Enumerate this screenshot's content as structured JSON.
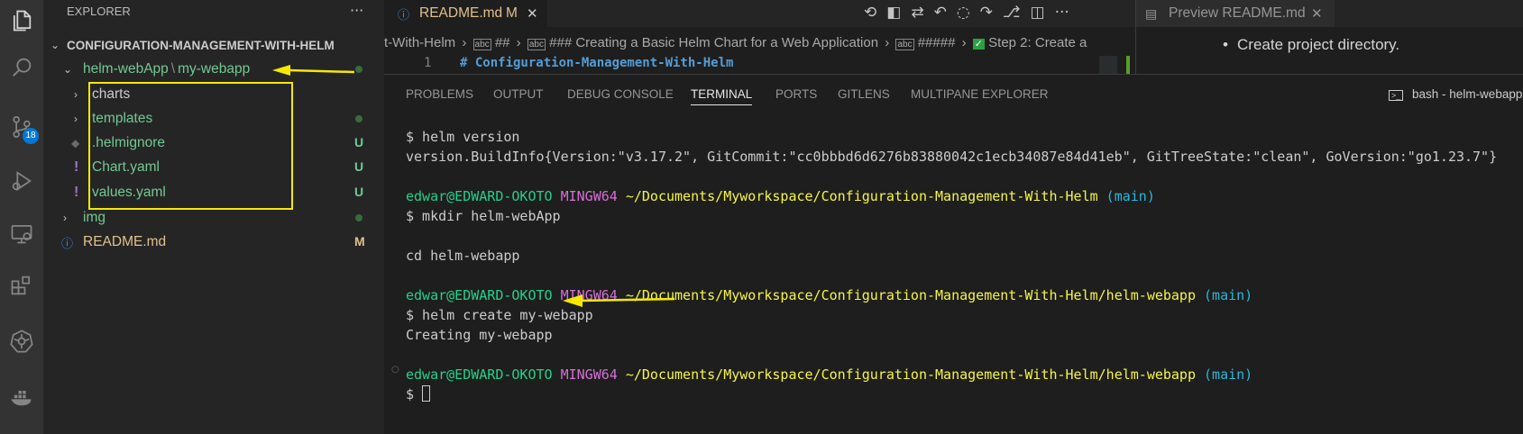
{
  "activity_bar": {
    "source_control_badge": "18",
    "icons": [
      "files-icon",
      "search-icon",
      "source-control-icon",
      "run-debug-icon",
      "remote-explorer-icon",
      "extensions-icon",
      "kubernetes-icon",
      "docker-icon"
    ]
  },
  "sidebar": {
    "title": "EXPLORER",
    "more": "···",
    "root": "CONFIGURATION-MANAGEMENT-WITH-HELM",
    "items": [
      {
        "label_a": "helm-webApp",
        "sep": "\\",
        "label_b": "my-webapp",
        "status": "dot"
      },
      {
        "label": "charts",
        "status": ""
      },
      {
        "label": "templates",
        "status": "dot"
      },
      {
        "label": ".helmignore",
        "status": "U"
      },
      {
        "label": "Chart.yaml",
        "status": "U"
      },
      {
        "label": "values.yaml",
        "status": "U"
      },
      {
        "label": "img",
        "status": "dot"
      },
      {
        "label": "README.md",
        "status": "M"
      }
    ]
  },
  "editor": {
    "tab_label": "README.md",
    "tab_status": "M",
    "tab_close": "✕",
    "breadcrumb": {
      "p1": "t-With-Helm",
      "p2": "##",
      "p3": "### Creating a Basic Helm Chart for a Web Application",
      "p4": "#####",
      "p5": "Step 2: Create a"
    },
    "line_number": "1",
    "line_text": "# Configuration-Management-With-Helm"
  },
  "preview": {
    "tab_label": "Preview README.md",
    "tab_close": "✕",
    "bullet": "Create project directory."
  },
  "panel": {
    "tabs": [
      "PROBLEMS",
      "OUTPUT",
      "DEBUG CONSOLE",
      "TERMINAL",
      "PORTS",
      "GITLENS",
      "MULTIPANE EXPLORER"
    ],
    "active_tab": "TERMINAL",
    "terminal_name": "bash - helm-webapp",
    "terminal": {
      "l1": "$ helm version",
      "l2": "version.BuildInfo{Version:\"v3.17.2\", GitCommit:\"cc0bbbd6d6276b83880042c1ecb34087e84d41eb\", GitTreeState:\"clean\", GoVersion:\"go1.23.7\"}",
      "user": "edwar@EDWARD-OKOTO",
      "host": "MINGW64",
      "path1": "~/Documents/Myworkspace/Configuration-Management-With-Helm",
      "branch": "(main)",
      "l4": "$ mkdir helm-webApp",
      "l5": "cd helm-webapp",
      "path2": "~/Documents/Myworkspace/Configuration-Management-With-Helm/helm-webapp",
      "l7": "$ helm create my-webapp",
      "l8": "Creating my-webapp",
      "prompt": "$ "
    }
  },
  "colors": {
    "annotation": "#f5e900",
    "accent": "#0078d4"
  }
}
